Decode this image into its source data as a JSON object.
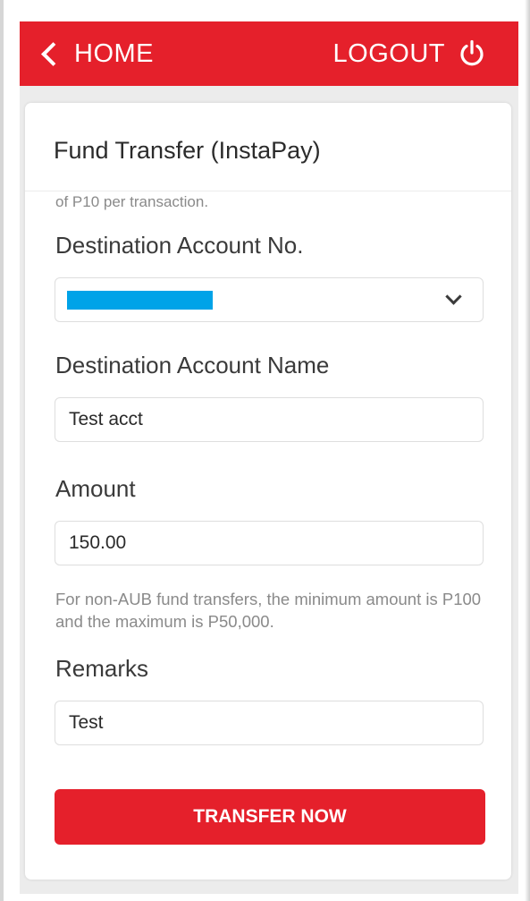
{
  "header": {
    "home_label": "HOME",
    "logout_label": "LOGOUT",
    "back_icon": "chevron-left-icon",
    "logout_icon": "power-icon",
    "bar_color": "#e5202b"
  },
  "form": {
    "title": "Fund Transfer (InstaPay)",
    "fee_note": "of P10 per transaction.",
    "destination_account_no": {
      "label": "Destination Account No.",
      "value_redacted": true,
      "redaction_color": "#00a3e8",
      "dropdown_icon": "chevron-down-icon"
    },
    "destination_account_name": {
      "label": "Destination Account Name",
      "value": "Test acct"
    },
    "amount": {
      "label": "Amount",
      "value": "150.00",
      "hint": "For non-AUB fund transfers, the minimum amount is P100 and the maximum is P50,000."
    },
    "remarks": {
      "label": "Remarks",
      "value": "Test"
    },
    "submit_label": "TRANSFER NOW"
  }
}
